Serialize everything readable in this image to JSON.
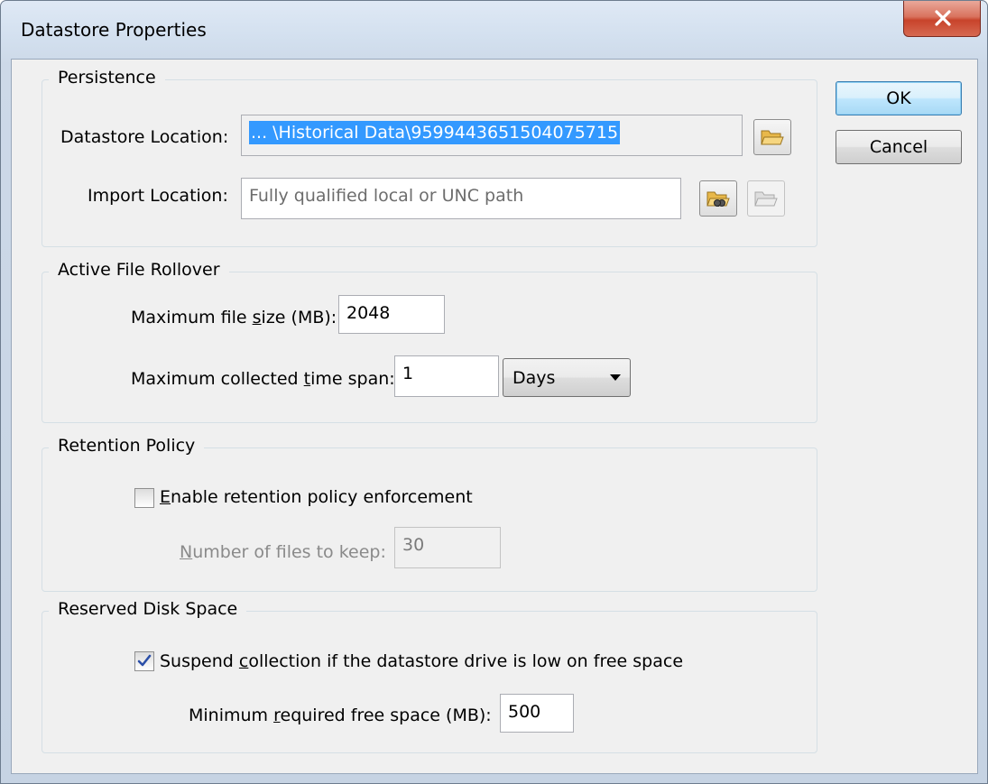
{
  "window": {
    "title": "Datastore Properties",
    "close_symbol": "X"
  },
  "persistence": {
    "title": "Persistence",
    "datastore_location_label": "Datastore Location:",
    "datastore_location_value": "... \\Historical Data\\9599443651504075715",
    "import_location_label": "Import Location:",
    "import_location_placeholder": "Fully qualified local or UNC path",
    "icons": [
      "folder-open-icon",
      "folder-search-icon",
      "folder-disabled-icon"
    ]
  },
  "rollover": {
    "title": "Active File Rollover",
    "max_size_label_pre": "Maximum file ",
    "max_size_label_u": "s",
    "max_size_label_post": "ize (MB):",
    "max_size_value": "2048",
    "max_span_label_pre": "Maximum collected ",
    "max_span_label_u": "t",
    "max_span_label_post": "ime span:",
    "max_span_value": "1",
    "span_unit": "Days"
  },
  "retention": {
    "title": "Retention Policy",
    "enable_checked": false,
    "enable_label_u": "E",
    "enable_label_post": "nable retention policy enforcement",
    "files_label_u": "N",
    "files_label_post": "umber of files to keep:",
    "files_value": "30"
  },
  "disk": {
    "title": "Reserved Disk Space",
    "suspend_checked": true,
    "suspend_label_pre": "Suspend ",
    "suspend_label_u": "c",
    "suspend_label_post": "ollection if the datastore drive is low on free space",
    "min_free_label_pre": "Minimum ",
    "min_free_label_u": "r",
    "min_free_label_post": "equired free space (MB):",
    "min_free_value": "500"
  },
  "buttons": {
    "ok": "OK",
    "cancel": "Cancel"
  },
  "colors": {
    "selection": "#3399ff",
    "close_red": "#c8432b",
    "default_button": "#bee6fd"
  }
}
